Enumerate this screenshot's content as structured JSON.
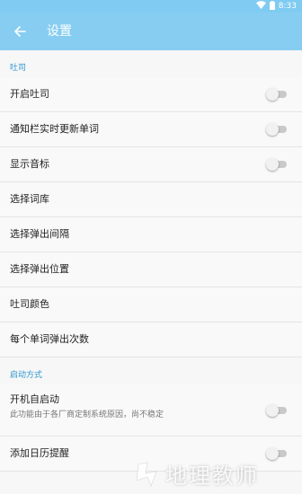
{
  "status_bar": {
    "time": "8:33",
    "icons": [
      "wifi-icon",
      "battery-icon"
    ]
  },
  "toolbar": {
    "title": "设置",
    "back_icon": "arrow-left-icon"
  },
  "colors": {
    "toolbar": "#87cdf2",
    "section_header": "#2d96cf",
    "switch_track_off": "#c9c9c9"
  },
  "sections": [
    {
      "header": "吐司",
      "items": [
        {
          "label": "开启吐司",
          "switch": true,
          "on": false
        },
        {
          "label": "通知栏实时更新单词",
          "switch": true,
          "on": false
        },
        {
          "label": "显示音标",
          "switch": true,
          "on": false
        },
        {
          "label": "选择词库",
          "switch": false
        },
        {
          "label": "选择弹出间隔",
          "switch": false
        },
        {
          "label": "选择弹出位置",
          "switch": false
        },
        {
          "label": "吐司颜色",
          "switch": false
        },
        {
          "label": "每个单词弹出次数",
          "switch": false
        }
      ]
    },
    {
      "header": "启动方式",
      "items": [
        {
          "label": "开机自启动",
          "subtitle": "此功能由于各厂商定制系统原因，尚不稳定",
          "switch": true,
          "on": false
        },
        {
          "label": "添加日历提醒",
          "switch": true,
          "on": false
        }
      ]
    }
  ],
  "watermark": {
    "text": "地理教师"
  }
}
